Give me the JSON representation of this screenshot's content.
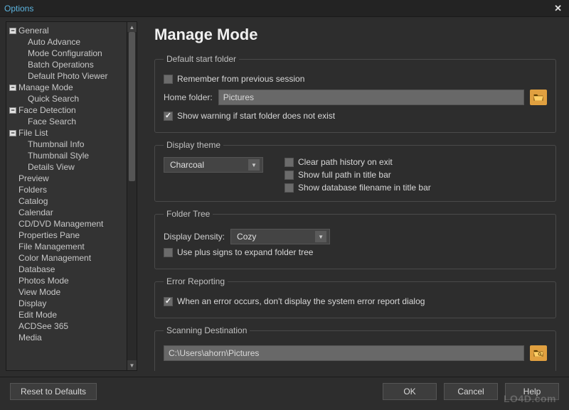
{
  "window": {
    "title": "Options"
  },
  "tree": {
    "items": [
      {
        "label": "General",
        "depth": 0,
        "toggle": "-"
      },
      {
        "label": "Auto Advance",
        "depth": 1
      },
      {
        "label": "Mode Configuration",
        "depth": 1
      },
      {
        "label": "Batch Operations",
        "depth": 1
      },
      {
        "label": "Default Photo Viewer",
        "depth": 1
      },
      {
        "label": "Manage Mode",
        "depth": 0,
        "toggle": "-"
      },
      {
        "label": "Quick Search",
        "depth": 1
      },
      {
        "label": "Face Detection",
        "depth": 0,
        "toggle": "-"
      },
      {
        "label": "Face Search",
        "depth": 1
      },
      {
        "label": "File List",
        "depth": 0,
        "toggle": "-"
      },
      {
        "label": "Thumbnail Info",
        "depth": 1
      },
      {
        "label": "Thumbnail Style",
        "depth": 1
      },
      {
        "label": "Details View",
        "depth": 1
      },
      {
        "label": "Preview",
        "depth": 0
      },
      {
        "label": "Folders",
        "depth": 0
      },
      {
        "label": "Catalog",
        "depth": 0
      },
      {
        "label": "Calendar",
        "depth": 0
      },
      {
        "label": "CD/DVD Management",
        "depth": 0
      },
      {
        "label": "Properties Pane",
        "depth": 0
      },
      {
        "label": "File Management",
        "depth": 0
      },
      {
        "label": "Color Management",
        "depth": 0
      },
      {
        "label": "Database",
        "depth": 0
      },
      {
        "label": "Photos Mode",
        "depth": 0
      },
      {
        "label": "View Mode",
        "depth": 0
      },
      {
        "label": "Display",
        "depth": 0
      },
      {
        "label": "Edit Mode",
        "depth": 0
      },
      {
        "label": "ACDSee 365",
        "depth": 0
      },
      {
        "label": "Media",
        "depth": 0
      }
    ]
  },
  "page": {
    "heading": "Manage Mode",
    "groups": {
      "start_folder": {
        "legend": "Default start folder",
        "remember": {
          "label": "Remember from previous session",
          "checked": false
        },
        "home_label": "Home folder:",
        "home_value": "Pictures",
        "warn": {
          "label": "Show warning if start folder does not exist",
          "checked": true
        }
      },
      "display_theme": {
        "legend": "Display theme",
        "value": "Charcoal",
        "clear_history": {
          "label": "Clear path history on exit",
          "checked": false
        },
        "full_path": {
          "label": "Show full path in title bar",
          "checked": false
        },
        "db_filename": {
          "label": "Show database filename in title bar",
          "checked": false
        }
      },
      "folder_tree": {
        "legend": "Folder Tree",
        "density_label": "Display Density:",
        "density_value": "Cozy",
        "plus_signs": {
          "label": "Use plus signs to expand folder tree",
          "checked": false
        }
      },
      "error_reporting": {
        "legend": "Error Reporting",
        "suppress": {
          "label": "When an error occurs, don't display the system error report dialog",
          "checked": true
        }
      },
      "scanning": {
        "legend": "Scanning Destination",
        "path": "C:\\Users\\ahorn\\Pictures"
      }
    }
  },
  "footer": {
    "reset": "Reset to Defaults",
    "ok": "OK",
    "cancel": "Cancel",
    "help": "Help"
  },
  "watermark": "LO4D.com"
}
